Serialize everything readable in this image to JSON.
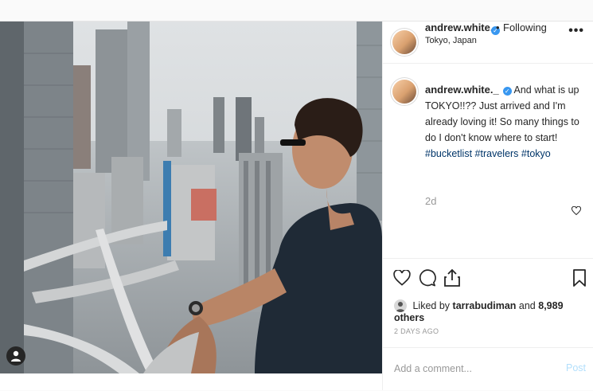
{
  "post": {
    "author": {
      "username": "andrew.white._",
      "verified": true,
      "follow_status": "Following",
      "separator": "•",
      "location": "Tokyo, Japan"
    },
    "more_label": "•••",
    "caption": {
      "username": "andrew.white._",
      "text": "And what is up TOKYO!!?? Just arrived and I'm already loving it! So many things to do I don't know where to start!",
      "hashtags": [
        "#bucketlist",
        "#travelers",
        "#tokyo"
      ],
      "time": "2d"
    },
    "likes": {
      "prefix": "Liked by",
      "user": "tarrabudiman",
      "joiner": "and",
      "others": "8,989 others"
    },
    "date": "2 DAYS AGO",
    "comment": {
      "placeholder": "Add a comment...",
      "post_label": "Post"
    },
    "icons": {
      "like": "heart-icon",
      "comment": "comment-icon",
      "share": "share-icon",
      "save": "bookmark-icon",
      "tag": "user-tag-icon",
      "comment_like": "small-heart-icon"
    },
    "colors": {
      "hashtag": "#003569",
      "verified": "#3897f0",
      "post_button": "#b2dffc",
      "muted": "#999999"
    }
  }
}
